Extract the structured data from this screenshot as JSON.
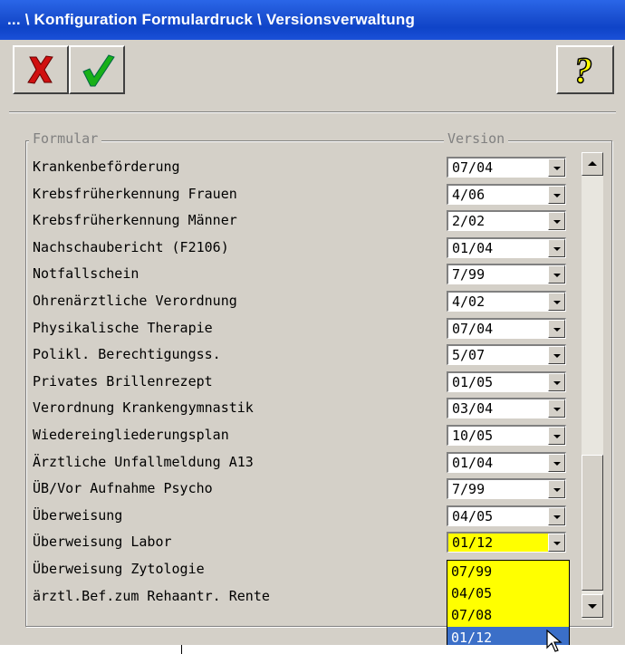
{
  "window": {
    "title": "... \\ Konfiguration Formulardruck \\ Versionsverwaltung"
  },
  "toolbar": {
    "cancel_icon": "red-x-icon",
    "ok_icon": "green-check-icon",
    "help_icon": "question-icon"
  },
  "group": {
    "col_formular": "Formular",
    "col_version": "Version"
  },
  "rows": [
    {
      "label": "Krankenbeförderung",
      "version": "07/04"
    },
    {
      "label": "Krebsfrüherkennung Frauen",
      "version": "4/06"
    },
    {
      "label": "Krebsfrüherkennung Männer",
      "version": "2/02"
    },
    {
      "label": "Nachschaubericht (F2106)",
      "version": "01/04"
    },
    {
      "label": "Notfallschein",
      "version": "7/99"
    },
    {
      "label": "Ohrenärztliche Verordnung",
      "version": "4/02"
    },
    {
      "label": "Physikalische Therapie",
      "version": "07/04"
    },
    {
      "label": "Polikl. Berechtigungss.",
      "version": "5/07"
    },
    {
      "label": "Privates Brillenrezept",
      "version": "01/05"
    },
    {
      "label": "Verordnung Krankengymnastik",
      "version": "03/04"
    },
    {
      "label": "Wiedereingliederungsplan",
      "version": "10/05"
    },
    {
      "label": "Ärztliche Unfallmeldung A13",
      "version": "01/04"
    },
    {
      "label": "ÜB/Vor Aufnahme Psycho",
      "version": "7/99"
    },
    {
      "label": "Überweisung",
      "version": "04/05"
    },
    {
      "label": "Überweisung Labor",
      "version": "01/12"
    },
    {
      "label": "Überweisung Zytologie",
      "version": ""
    },
    {
      "label": "ärztl.Bef.zum Rehaantr. Rente",
      "version": ""
    }
  ],
  "dropdown_options": [
    "07/99",
    "04/05",
    "07/08",
    "01/12"
  ],
  "dropdown_selected": "01/12"
}
